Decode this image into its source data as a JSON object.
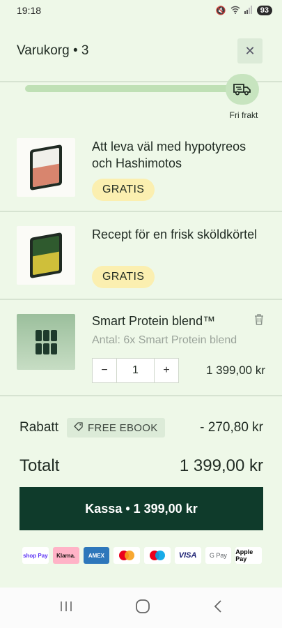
{
  "status_bar": {
    "time": "19:18",
    "battery": "93"
  },
  "header": {
    "title": "Varukorg • 3",
    "close_icon": "close-icon"
  },
  "shipping": {
    "label": "Fri frakt",
    "progress": 1.0,
    "icon": "truck-icon"
  },
  "items": [
    {
      "title": "Att leva väl med hypotyreos och Hashimotos",
      "badge": "GRATIS"
    },
    {
      "title": "Recept för en frisk sköldkörtel",
      "badge": "GRATIS"
    },
    {
      "title": "Smart Protein blend™",
      "subtitle": "Antal: 6x Smart Protein blend",
      "quantity": "1",
      "price": "1 399,00 kr",
      "minus": "−",
      "plus": "+"
    }
  ],
  "discount": {
    "label": "Rabatt",
    "code": "FREE EBOOK",
    "value": "- 270,80 kr"
  },
  "total": {
    "label": "Totalt",
    "value": "1 399,00 kr"
  },
  "checkout": {
    "label": "Kassa • 1 399,00 kr"
  },
  "payments": [
    "shop Pay",
    "Klarna.",
    "AMEX",
    "mastercard",
    "maestro",
    "VISA",
    "G Pay",
    "Apple Pay"
  ],
  "colors": {
    "background": "#eef8e8",
    "checkout": "#0f3b2b",
    "badge": "#fbefb0",
    "progress": "#bfe0b5"
  }
}
